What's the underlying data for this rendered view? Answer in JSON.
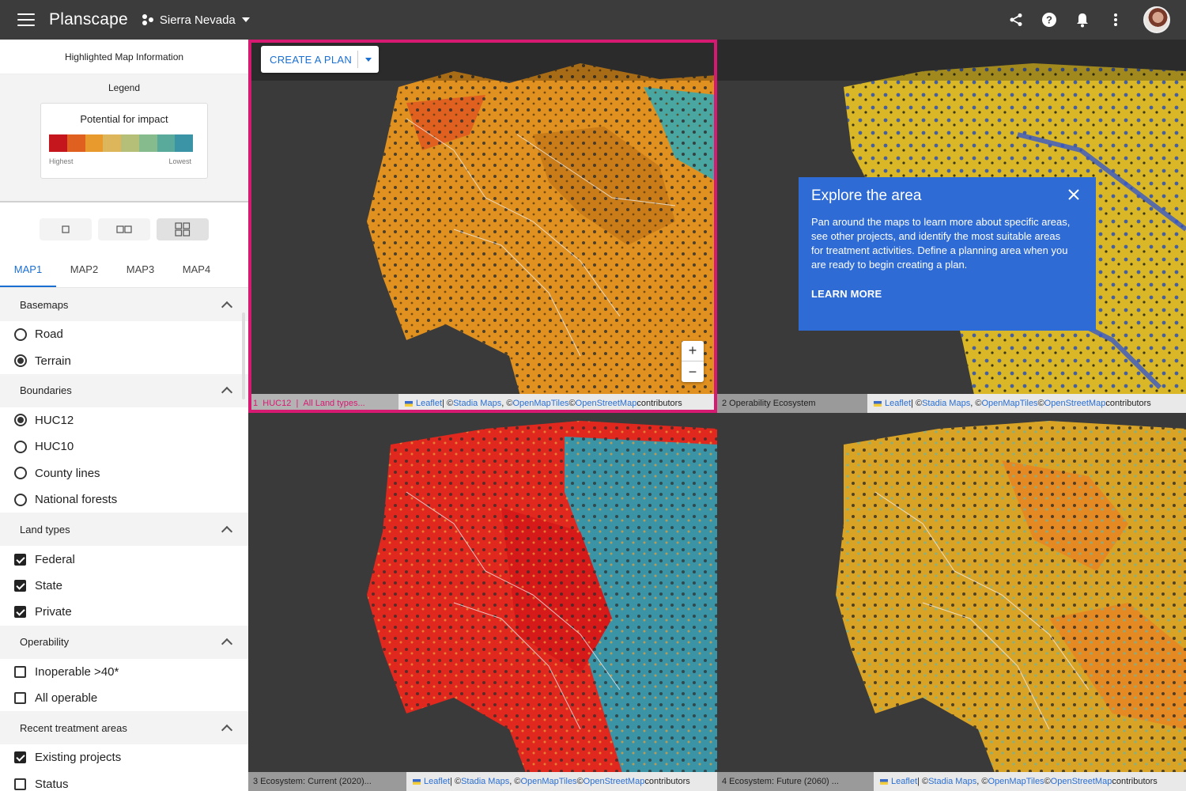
{
  "app": {
    "title": "Planscape",
    "region": "Sierra Nevada"
  },
  "sidebar": {
    "info_header": "Highlighted Map Information",
    "legend": {
      "title": "Legend",
      "card_title": "Potential for impact",
      "colors": [
        "#c4161c",
        "#e0601f",
        "#e99a2c",
        "#ddb55b",
        "#b6bf78",
        "#86bb8e",
        "#5aaa9c",
        "#3b93a6"
      ],
      "high_label": "Highest",
      "low_label": "Lowest"
    },
    "tabs": [
      "MAP1",
      "MAP2",
      "MAP3",
      "MAP4"
    ],
    "sections": {
      "basemaps": {
        "title": "Basemaps",
        "options": [
          "Road",
          "Terrain"
        ]
      },
      "boundaries": {
        "title": "Boundaries",
        "options": [
          "HUC12",
          "HUC10",
          "County lines",
          "National forests"
        ]
      },
      "land_types": {
        "title": "Land types",
        "options": [
          "Federal",
          "State",
          "Private"
        ]
      },
      "operability": {
        "title": "Operability",
        "options": [
          "Inoperable >40*",
          "All operable"
        ]
      },
      "recent": {
        "title": "Recent treatment areas",
        "options": [
          "Existing projects",
          "Status"
        ]
      }
    }
  },
  "maps": {
    "plan_button": "CREATE A PLAN",
    "attribution": {
      "leaflet": "Leaflet",
      "sep": " | © ",
      "stadia": "Stadia Maps",
      "c1": ", © ",
      "omt": "OpenMapTiles",
      "c2": " © ",
      "osm": "OpenStreetMap",
      "tail": " contributors"
    },
    "map1": {
      "num": "1",
      "name": "HUC12",
      "sub": "All Land types..."
    },
    "map2": {
      "label": "2  Operability Ecosystem"
    },
    "map3": {
      "label": "3  Ecosystem: Current (2020)..."
    },
    "map4": {
      "label": "4  Ecosystem: Future (2060) ..."
    },
    "zoom_in": "+",
    "zoom_out": "−"
  },
  "popup": {
    "title": "Explore the area",
    "body": "Pan around the maps to learn more about specific areas, see other projects, and identify the most suitable areas for treatment activities. Define a planning area when you are ready to begin creating a plan.",
    "learn_more": "LEARN MORE"
  }
}
